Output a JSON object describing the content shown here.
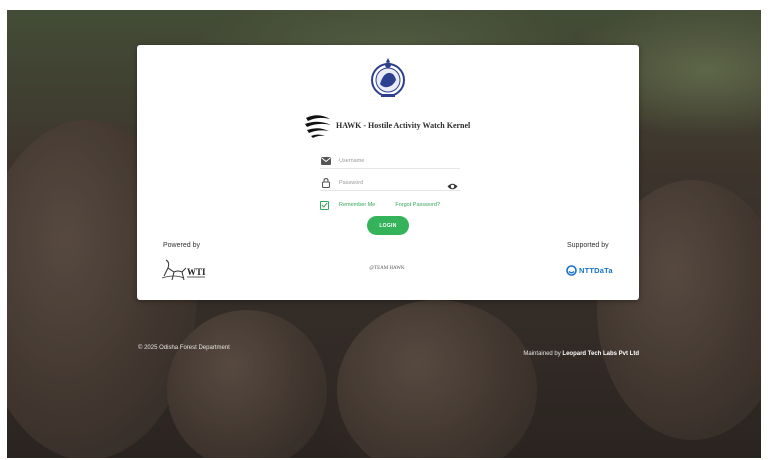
{
  "app": {
    "title": "HAWK - Hostile Activity Watch Kernel"
  },
  "login": {
    "username_placeholder": "Username",
    "password_placeholder": "Password",
    "remember_label": "Remember Me",
    "forgot_label": "Forgot Password?",
    "login_label": "LOGIN"
  },
  "credits": {
    "powered_by": "Powered by",
    "supported_by": "Supported by",
    "wti_logo_text": "WTI",
    "team_label": "@TEAM HAWK",
    "ntt_logo_text": "NTTDaTa"
  },
  "footer": {
    "copyright": "© 2025 Odisha Forest Department",
    "maintained_prefix": "Maintained by",
    "maintained_company": "Leopard Tech Labs Pvt Ltd"
  },
  "colors": {
    "accent_green": "#35b35b",
    "ntt_blue": "#1a73c9"
  },
  "icons": [
    "odisha-emblem-icon",
    "hawk-logo-icon",
    "envelope-icon",
    "lock-icon",
    "eye-icon",
    "checkbox-icon",
    "wti-logo-icon",
    "ntt-data-logo-icon"
  ]
}
